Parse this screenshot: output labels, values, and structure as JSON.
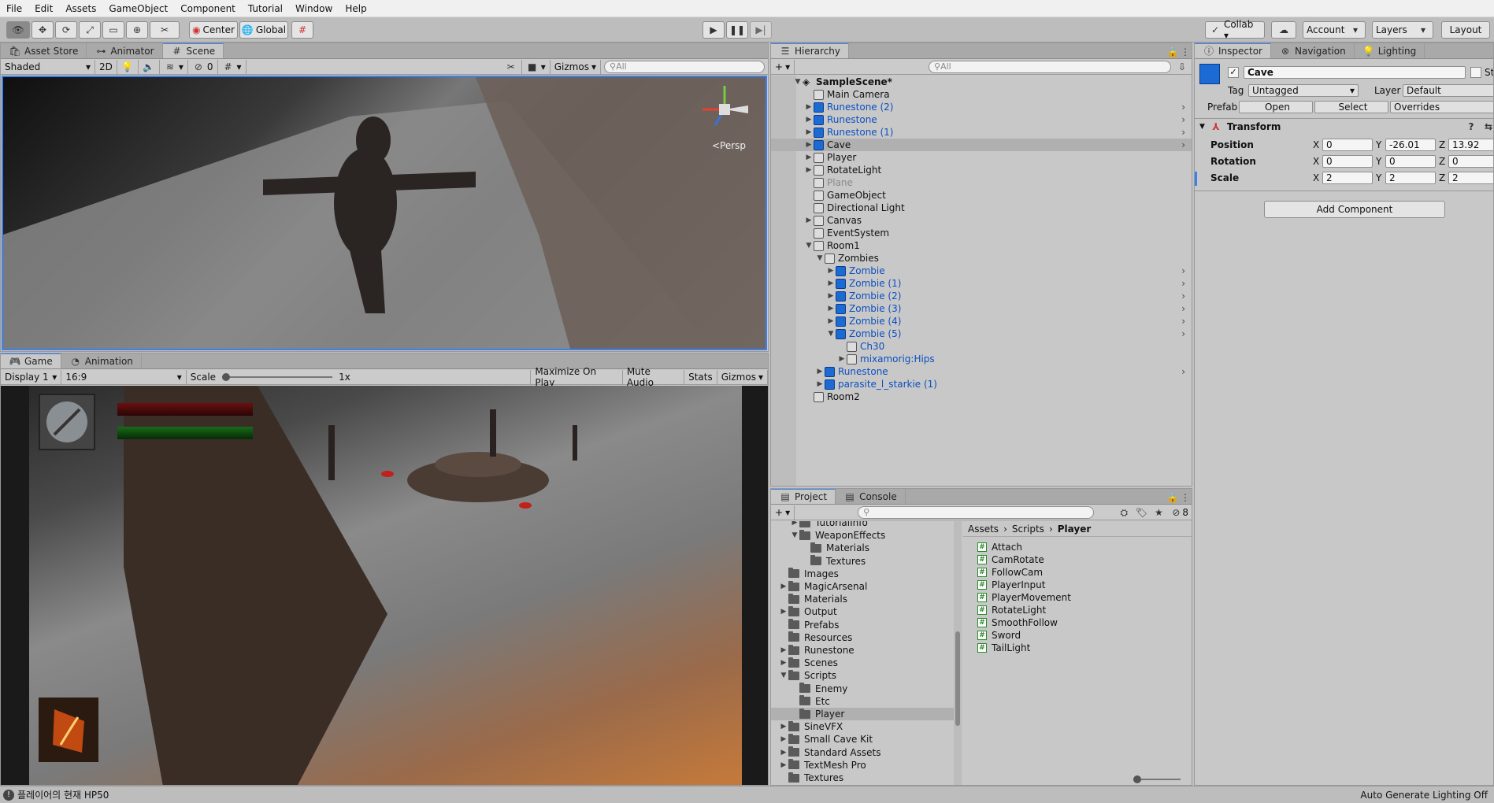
{
  "menu": [
    "File",
    "Edit",
    "Assets",
    "GameObject",
    "Component",
    "Tutorial",
    "Window",
    "Help"
  ],
  "toolbar": {
    "center": "Center",
    "global": "Global",
    "collab": "Collab ▾",
    "account": "Account",
    "layers": "Layers",
    "layout": "Layout"
  },
  "scene_panel": {
    "tabs": [
      "Asset Store",
      "Animator",
      "Scene"
    ],
    "shading": "Shaded",
    "mode2d": "2D",
    "hidden_count": "0",
    "gizmos": "Gizmos",
    "search_placeholder": "All",
    "persp": "<Persp"
  },
  "game_panel": {
    "tabs": [
      "Game",
      "Animation"
    ],
    "display": "Display 1",
    "aspect": "16:9",
    "scale_label": "Scale",
    "scale_value": "1x",
    "maximize": "Maximize On Play",
    "mute": "Mute Audio",
    "stats": "Stats",
    "gizmos": "Gizmos"
  },
  "hierarchy": {
    "tab": "Hierarchy",
    "search_placeholder": "All",
    "items": [
      {
        "label": "SampleScene*",
        "depth": 0,
        "arrow": "▼",
        "icon": "unity-scene",
        "color": "normal",
        "bold": true
      },
      {
        "label": "Main Camera",
        "depth": 1,
        "arrow": "",
        "icon": "grey",
        "color": "normal"
      },
      {
        "label": "Runestone (2)",
        "depth": 1,
        "arrow": "▶",
        "icon": "blue",
        "color": "blue",
        "chev": true
      },
      {
        "label": "Runestone",
        "depth": 1,
        "arrow": "▶",
        "icon": "blue",
        "color": "blue",
        "chev": true
      },
      {
        "label": "Runestone (1)",
        "depth": 1,
        "arrow": "▶",
        "icon": "blue",
        "color": "blue",
        "chev": true
      },
      {
        "label": "Cave",
        "depth": 1,
        "arrow": "▶",
        "icon": "blue",
        "color": "normal",
        "chev": true,
        "selected": true
      },
      {
        "label": "Player",
        "depth": 1,
        "arrow": "▶",
        "icon": "grey",
        "color": "normal"
      },
      {
        "label": "RotateLight",
        "depth": 1,
        "arrow": "▶",
        "icon": "grey",
        "color": "normal"
      },
      {
        "label": "Plane",
        "depth": 1,
        "arrow": "",
        "icon": "grey",
        "color": "dim"
      },
      {
        "label": "GameObject",
        "depth": 1,
        "arrow": "",
        "icon": "grey",
        "color": "normal"
      },
      {
        "label": "Directional Light",
        "depth": 1,
        "arrow": "",
        "icon": "grey",
        "color": "normal"
      },
      {
        "label": "Canvas",
        "depth": 1,
        "arrow": "▶",
        "icon": "grey",
        "color": "normal"
      },
      {
        "label": "EventSystem",
        "depth": 1,
        "arrow": "",
        "icon": "grey",
        "color": "normal"
      },
      {
        "label": "Room1",
        "depth": 1,
        "arrow": "▼",
        "icon": "grey",
        "color": "normal"
      },
      {
        "label": "Zombies",
        "depth": 2,
        "arrow": "▼",
        "icon": "grey",
        "color": "normal"
      },
      {
        "label": "Zombie",
        "depth": 3,
        "arrow": "▶",
        "icon": "blue",
        "color": "blue",
        "chev": true
      },
      {
        "label": "Zombie (1)",
        "depth": 3,
        "arrow": "▶",
        "icon": "blue",
        "color": "blue",
        "chev": true
      },
      {
        "label": "Zombie (2)",
        "depth": 3,
        "arrow": "▶",
        "icon": "blue",
        "color": "blue",
        "chev": true
      },
      {
        "label": "Zombie (3)",
        "depth": 3,
        "arrow": "▶",
        "icon": "blue",
        "color": "blue",
        "chev": true
      },
      {
        "label": "Zombie (4)",
        "depth": 3,
        "arrow": "▶",
        "icon": "blue",
        "color": "blue",
        "chev": true
      },
      {
        "label": "Zombie (5)",
        "depth": 3,
        "arrow": "▼",
        "icon": "blue",
        "color": "blue",
        "chev": true
      },
      {
        "label": "Ch30",
        "depth": 4,
        "arrow": "",
        "icon": "grey",
        "color": "blue"
      },
      {
        "label": "mixamorig:Hips",
        "depth": 4,
        "arrow": "▶",
        "icon": "grey",
        "color": "blue"
      },
      {
        "label": "Runestone",
        "depth": 2,
        "arrow": "▶",
        "icon": "blue",
        "color": "blue",
        "chev": true
      },
      {
        "label": "parasite_l_starkie (1)",
        "depth": 2,
        "arrow": "▶",
        "icon": "blue",
        "color": "blue"
      },
      {
        "label": "Room2",
        "depth": 1,
        "arrow": "",
        "icon": "grey",
        "color": "normal"
      }
    ]
  },
  "inspector": {
    "tabs": [
      "Inspector",
      "Navigation",
      "Lighting"
    ],
    "object_name": "Cave",
    "static_label": "Stati",
    "tag_label": "Tag",
    "tag_value": "Untagged",
    "layer_label": "Layer",
    "layer_value": "Default",
    "prefab_label": "Prefab",
    "open": "Open",
    "select": "Select",
    "overrides": "Overrides",
    "transform_title": "Transform",
    "rows": [
      {
        "label": "Position",
        "x": "0",
        "y": "-26.01",
        "z": "13.92"
      },
      {
        "label": "Rotation",
        "x": "0",
        "y": "0",
        "z": "0"
      },
      {
        "label": "Scale",
        "x": "2",
        "y": "2",
        "z": "2"
      }
    ],
    "axis": {
      "x": "X",
      "y": "Y",
      "z": "Z"
    },
    "add_component": "Add Component"
  },
  "project": {
    "tabs": [
      "Project",
      "Console"
    ],
    "hidden_count": "8",
    "breadcrumb": [
      "Assets",
      "Scripts",
      "Player"
    ],
    "folders": [
      {
        "label": "TutorialInfo",
        "depth": 2,
        "arrow": "▶"
      },
      {
        "label": "WeaponEffects",
        "depth": 2,
        "arrow": "▼"
      },
      {
        "label": "Materials",
        "depth": 3,
        "arrow": ""
      },
      {
        "label": "Textures",
        "depth": 3,
        "arrow": ""
      },
      {
        "label": "Images",
        "depth": 1,
        "arrow": ""
      },
      {
        "label": "MagicArsenal",
        "depth": 1,
        "arrow": "▶"
      },
      {
        "label": "Materials",
        "depth": 1,
        "arrow": ""
      },
      {
        "label": "Output",
        "depth": 1,
        "arrow": "▶"
      },
      {
        "label": "Prefabs",
        "depth": 1,
        "arrow": ""
      },
      {
        "label": "Resources",
        "depth": 1,
        "arrow": ""
      },
      {
        "label": "Runestone",
        "depth": 1,
        "arrow": "▶"
      },
      {
        "label": "Scenes",
        "depth": 1,
        "arrow": "▶"
      },
      {
        "label": "Scripts",
        "depth": 1,
        "arrow": "▼"
      },
      {
        "label": "Enemy",
        "depth": 2,
        "arrow": ""
      },
      {
        "label": "Etc",
        "depth": 2,
        "arrow": ""
      },
      {
        "label": "Player",
        "depth": 2,
        "arrow": "",
        "selected": true
      },
      {
        "label": "SineVFX",
        "depth": 1,
        "arrow": "▶"
      },
      {
        "label": "Small Cave Kit",
        "depth": 1,
        "arrow": "▶"
      },
      {
        "label": "Standard Assets",
        "depth": 1,
        "arrow": "▶"
      },
      {
        "label": "TextMesh Pro",
        "depth": 1,
        "arrow": "▶"
      },
      {
        "label": "Textures",
        "depth": 1,
        "arrow": ""
      }
    ],
    "scripts": [
      "Attach",
      "CamRotate",
      "FollowCam",
      "PlayerInput",
      "PlayerMovement",
      "RotateLight",
      "SmoothFollow",
      "Sword",
      "TailLight"
    ]
  },
  "status": {
    "message": "플레이어의 현재 HP50",
    "right": "Auto Generate Lighting Off"
  }
}
